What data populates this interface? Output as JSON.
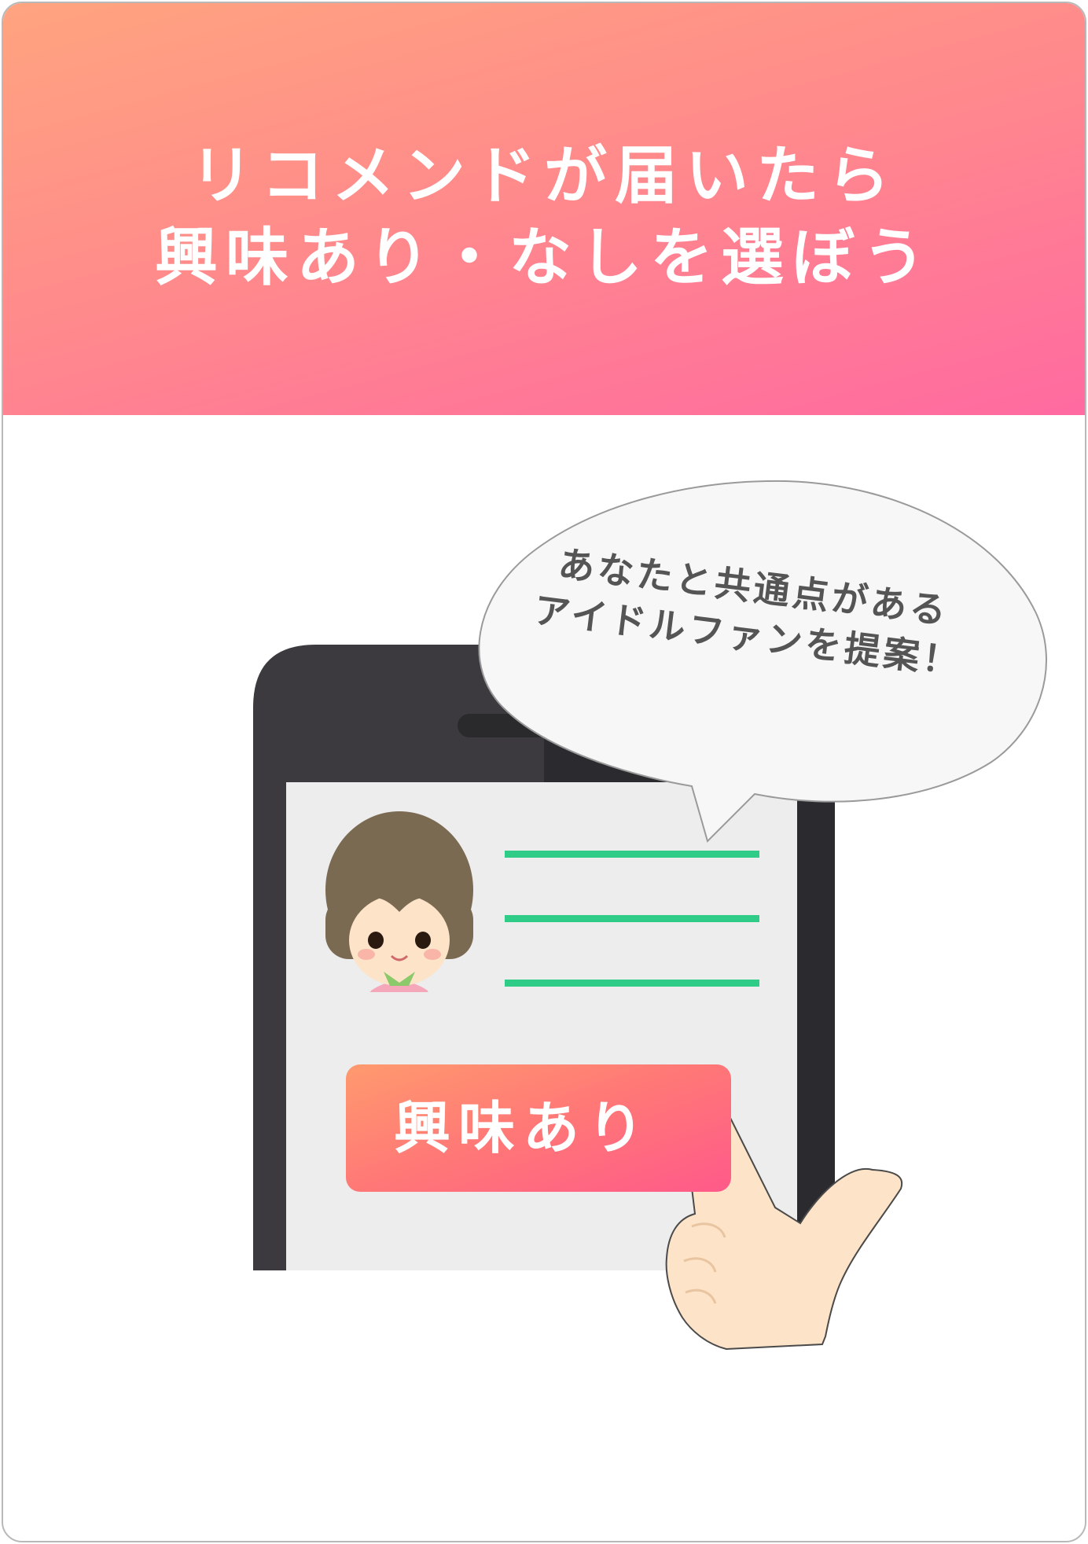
{
  "header": {
    "title_line1": "リコメンドが届いたら",
    "title_line2": "興味あり・なしを選ぼう"
  },
  "speech_bubble": {
    "line1": "あなたと共通点がある",
    "line2": "アイドルファンを提案！"
  },
  "phone": {
    "interest_button_label": "興味あり"
  },
  "colors": {
    "header_gradient_start": "#ffa47f",
    "header_gradient_end": "#ff6aa0",
    "accent_lines": "#2ecc87",
    "button_gradient_start": "#ff9a6e",
    "button_gradient_end": "#ff5a8a",
    "phone_body": "#3d3a3f"
  }
}
